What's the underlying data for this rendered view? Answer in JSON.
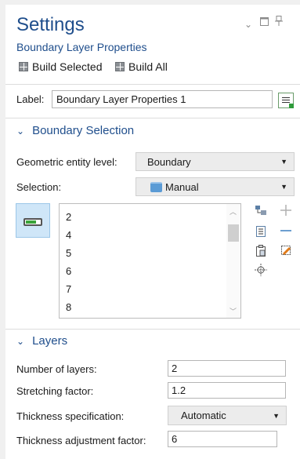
{
  "header": {
    "title": "Settings",
    "subtitle": "Boundary Layer Properties",
    "build_selected": "Build Selected",
    "build_all": "Build All",
    "icons": [
      "chevron-down-icon",
      "maximize-icon",
      "pin-icon"
    ]
  },
  "label_row": {
    "label": "Label:",
    "value": "Boundary Layer Properties 1"
  },
  "boundary_selection": {
    "header": "Boundary Selection",
    "geom_level_label": "Geometric entity level:",
    "geom_level_value": "Boundary",
    "selection_label": "Selection:",
    "selection_value": "Manual",
    "list_items": [
      "2",
      "4",
      "5",
      "6",
      "7",
      "8"
    ]
  },
  "layers": {
    "header": "Layers",
    "num_layers_label": "Number of layers:",
    "num_layers_value": "2",
    "stretch_label": "Stretching factor:",
    "stretch_value": "1.2",
    "thick_spec_label": "Thickness specification:",
    "thick_spec_value": "Automatic",
    "thick_adj_label": "Thickness adjustment factor:",
    "thick_adj_value": "6"
  },
  "colors": {
    "accent": "#1f4e8c",
    "selected_toggle": "#cfe6f8"
  }
}
